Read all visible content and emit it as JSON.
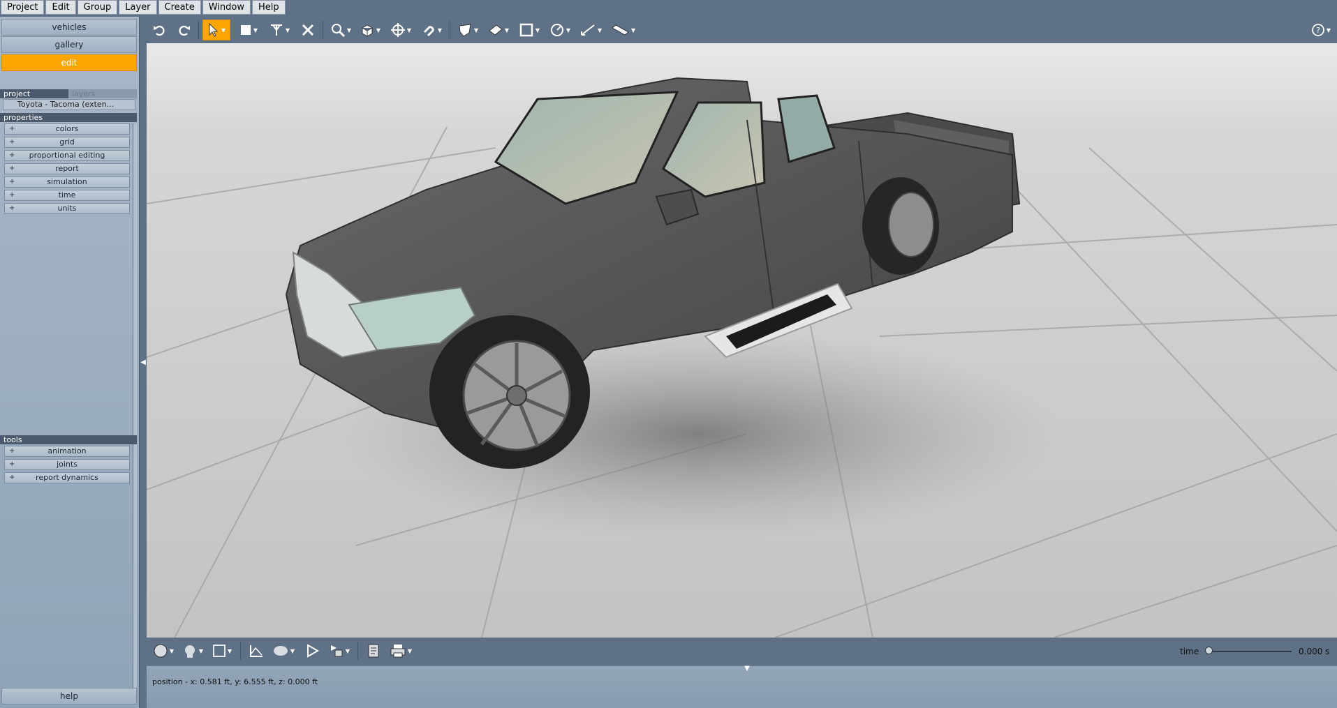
{
  "menubar": [
    "Project",
    "Edit",
    "Group",
    "Layer",
    "Create",
    "Window",
    "Help"
  ],
  "left_panel": {
    "nav": {
      "vehicles": "vehicles",
      "gallery": "gallery",
      "edit": "edit"
    },
    "tabs": {
      "project": "project",
      "layers": "layers"
    },
    "project_item": "Toyota - Tacoma (exten...",
    "properties_header": "properties",
    "properties": [
      "colors",
      "grid",
      "proportional editing",
      "report",
      "simulation",
      "time",
      "units"
    ],
    "tools_header": "tools",
    "tools": [
      "animation",
      "joints",
      "report dynamics"
    ],
    "help": "help",
    "plus": "+"
  },
  "toolbar": {
    "icons": [
      "undo-icon",
      "redo-icon",
      "select-arrow-icon",
      "rectangle-select-icon",
      "joint-icon",
      "delete-icon",
      "zoom-icon",
      "box-icon",
      "move-icon",
      "magnet-icon",
      "shield-icon",
      "plane-icon",
      "frame-icon",
      "gauge-icon",
      "measure-icon",
      "ruler-icon",
      "help-icon"
    ],
    "active": "select-arrow-icon"
  },
  "bottombar": {
    "time_label": "time",
    "time_value": "0.000 s",
    "time_position": 0
  },
  "statusbar": {
    "text": "position - x: 0.581 ft, y: 6.555 ft, z: 0.000 ft"
  },
  "colors": {
    "accent": "#ffa500",
    "chrome": "#5f7186",
    "panel": "#a9b7c7",
    "truck": "#5a5a5c"
  }
}
